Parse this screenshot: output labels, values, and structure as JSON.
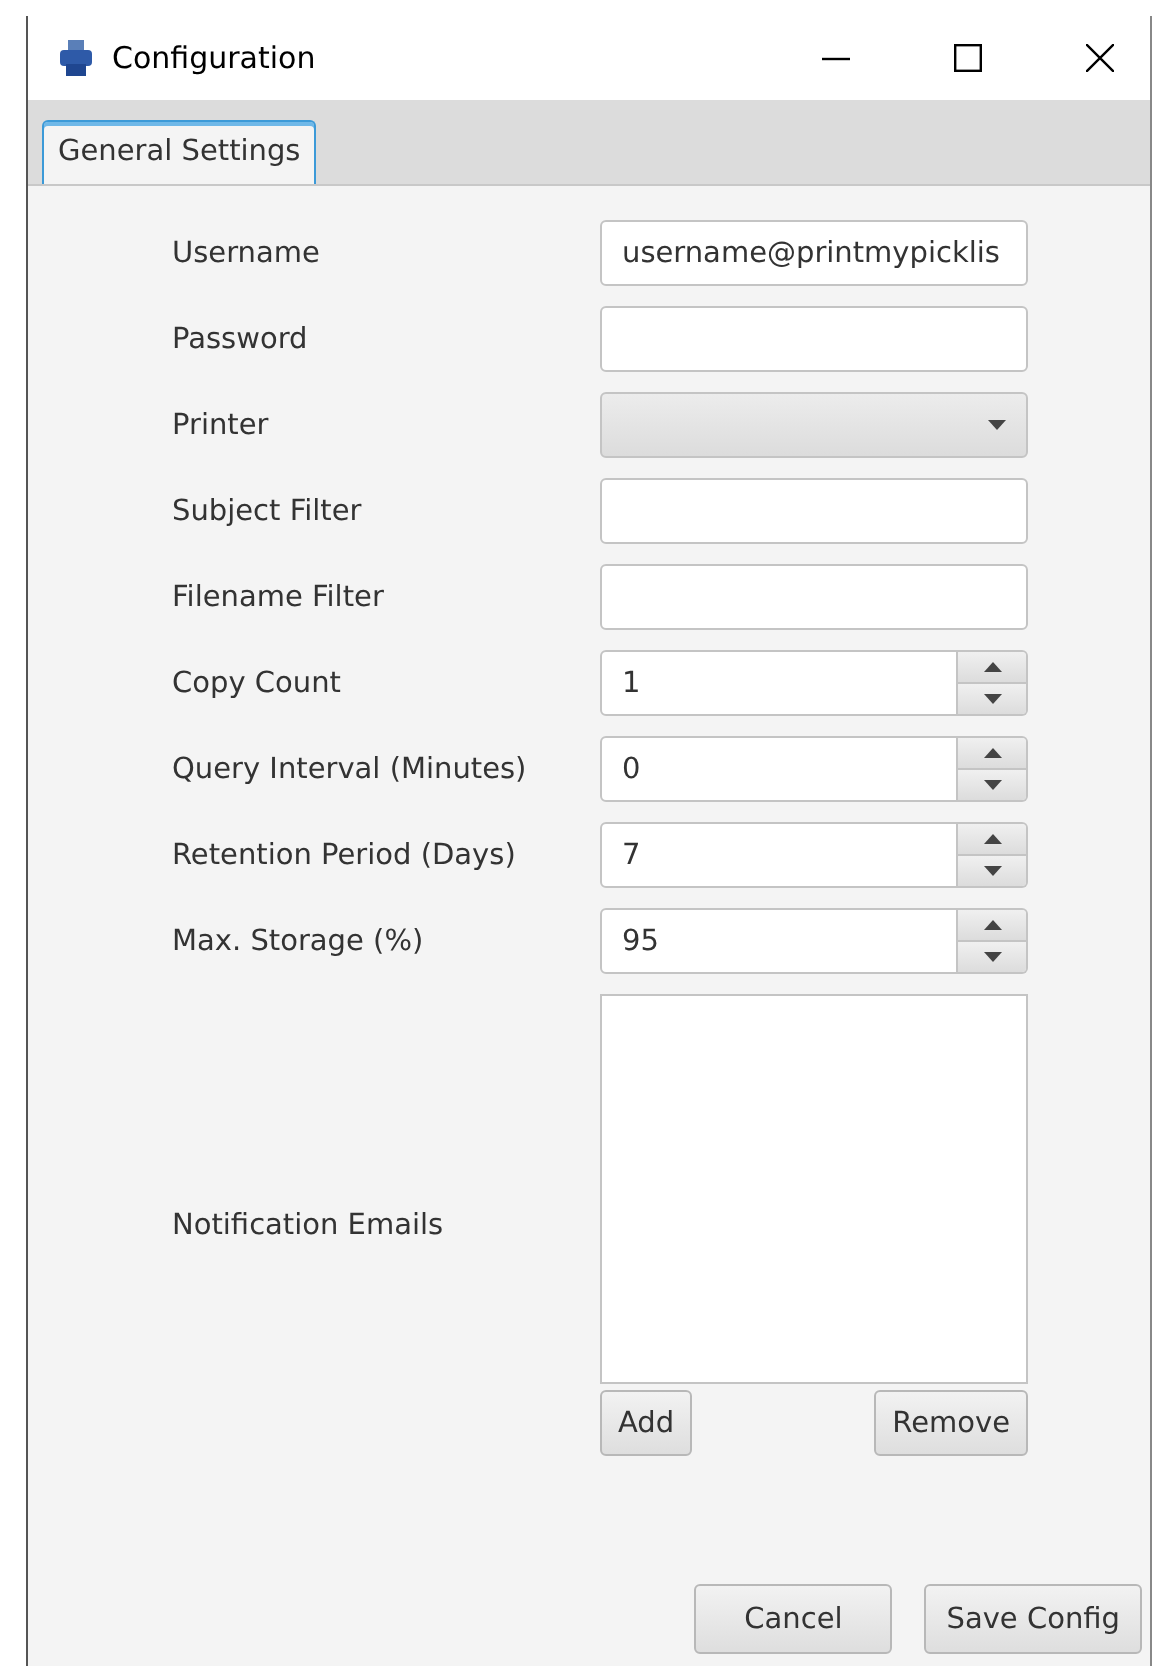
{
  "window": {
    "title": "Configuration"
  },
  "tabs": [
    {
      "label": "General Settings",
      "selected": true
    }
  ],
  "fields": [
    {
      "kind": "text",
      "label": "Username",
      "value": "username@printmypicklis"
    },
    {
      "kind": "password",
      "label": "Password"
    },
    {
      "kind": "combo",
      "label": "Printer"
    },
    {
      "kind": "text",
      "label": "Subject Filter"
    },
    {
      "kind": "text",
      "label": "Filename Filter"
    },
    {
      "kind": "spinner",
      "label": "Copy Count",
      "value": "1"
    },
    {
      "kind": "spinner",
      "label": "Query Interval (Minutes)",
      "value": "0"
    },
    {
      "kind": "spinner",
      "label": "Retention Period (Days)",
      "value": "7"
    },
    {
      "kind": "spinner",
      "label": "Max. Storage (%)",
      "value": "95"
    },
    {
      "kind": "list",
      "label": "Notification Emails",
      "buttons": [
        "Add",
        "Remove"
      ]
    }
  ],
  "buttons": [
    "Cancel",
    "Save Config"
  ]
}
